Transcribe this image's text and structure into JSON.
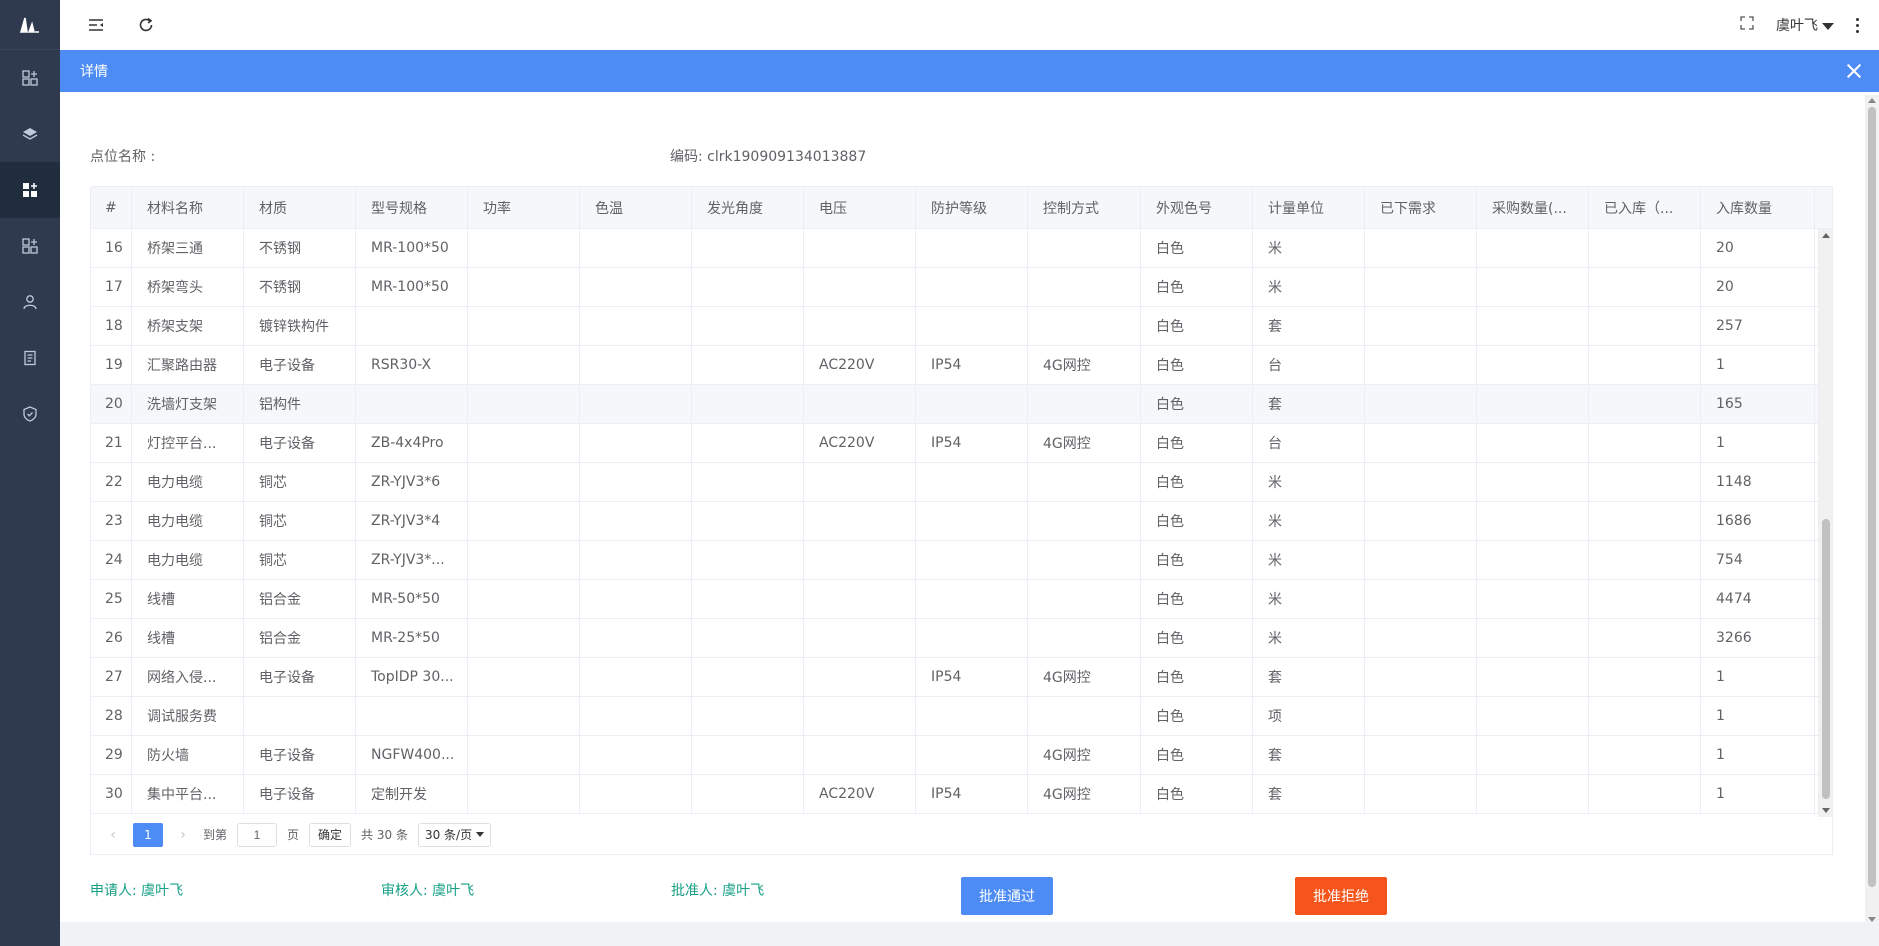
{
  "header": {
    "user_name": "虞叶飞"
  },
  "dialog": {
    "title": "详情",
    "point_name_label": "点位名称 :",
    "code_label": "编码: clrk190909134013887"
  },
  "table": {
    "columns": [
      "#",
      "材料名称",
      "材质",
      "型号规格",
      "功率",
      "色温",
      "发光角度",
      "电压",
      "防护等级",
      "控制方式",
      "外观色号",
      "计量单位",
      "已下需求",
      "采购数量(...",
      "已入库（...",
      "入库数量"
    ],
    "rows": [
      [
        "16",
        "桥架三通",
        "不锈钢",
        "MR-100*50",
        "",
        "",
        "",
        "",
        "",
        "",
        "白色",
        "米",
        "",
        "",
        "",
        "20"
      ],
      [
        "17",
        "桥架弯头",
        "不锈钢",
        "MR-100*50",
        "",
        "",
        "",
        "",
        "",
        "",
        "白色",
        "米",
        "",
        "",
        "",
        "20"
      ],
      [
        "18",
        "桥架支架",
        "镀锌铁构件",
        "",
        "",
        "",
        "",
        "",
        "",
        "",
        "白色",
        "套",
        "",
        "",
        "",
        "257"
      ],
      [
        "19",
        "汇聚路由器",
        "电子设备",
        "RSR30-X",
        "",
        "",
        "",
        "AC220V",
        "IP54",
        "4G网控",
        "白色",
        "台",
        "",
        "",
        "",
        "1"
      ],
      [
        "20",
        "洗墙灯支架",
        "铝构件",
        "",
        "",
        "",
        "",
        "",
        "",
        "",
        "白色",
        "套",
        "",
        "",
        "",
        "165"
      ],
      [
        "21",
        "灯控平台...",
        "电子设备",
        "ZB-4x4Pro",
        "",
        "",
        "",
        "AC220V",
        "IP54",
        "4G网控",
        "白色",
        "台",
        "",
        "",
        "",
        "1"
      ],
      [
        "22",
        "电力电缆",
        "铜芯",
        "ZR-YJV3*6",
        "",
        "",
        "",
        "",
        "",
        "",
        "白色",
        "米",
        "",
        "",
        "",
        "1148"
      ],
      [
        "23",
        "电力电缆",
        "铜芯",
        "ZR-YJV3*4",
        "",
        "",
        "",
        "",
        "",
        "",
        "白色",
        "米",
        "",
        "",
        "",
        "1686"
      ],
      [
        "24",
        "电力电缆",
        "铜芯",
        "ZR-YJV3*...",
        "",
        "",
        "",
        "",
        "",
        "",
        "白色",
        "米",
        "",
        "",
        "",
        "754"
      ],
      [
        "25",
        "线槽",
        "铝合金",
        "MR-50*50",
        "",
        "",
        "",
        "",
        "",
        "",
        "白色",
        "米",
        "",
        "",
        "",
        "4474"
      ],
      [
        "26",
        "线槽",
        "铝合金",
        "MR-25*50",
        "",
        "",
        "",
        "",
        "",
        "",
        "白色",
        "米",
        "",
        "",
        "",
        "3266"
      ],
      [
        "27",
        "网络入侵...",
        "电子设备",
        "TopIDP 30...",
        "",
        "",
        "",
        "",
        "IP54",
        "4G网控",
        "白色",
        "套",
        "",
        "",
        "",
        "1"
      ],
      [
        "28",
        "调试服务费",
        "",
        "",
        "",
        "",
        "",
        "",
        "",
        "",
        "白色",
        "项",
        "",
        "",
        "",
        "1"
      ],
      [
        "29",
        "防火墙",
        "电子设备",
        "NGFW400...",
        "",
        "",
        "",
        "",
        "",
        "4G网控",
        "白色",
        "套",
        "",
        "",
        "",
        "1"
      ],
      [
        "30",
        "集中平台...",
        "电子设备",
        "定制开发",
        "",
        "",
        "",
        "AC220V",
        "IP54",
        "4G网控",
        "白色",
        "套",
        "",
        "",
        "",
        "1"
      ]
    ],
    "highlighted_row": 4
  },
  "pager": {
    "current_page": "1",
    "goto_label": "到第",
    "goto_value": "1",
    "page_unit": "页",
    "confirm": "确定",
    "total": "共 30 条",
    "page_size": "30 条/页"
  },
  "footer": {
    "applicant": "申请人: 虞叶飞",
    "reviewer": "审核人: 虞叶飞",
    "approver": "批准人: 虞叶飞",
    "approve_button": "批准通过",
    "reject_button": "批准拒绝"
  }
}
